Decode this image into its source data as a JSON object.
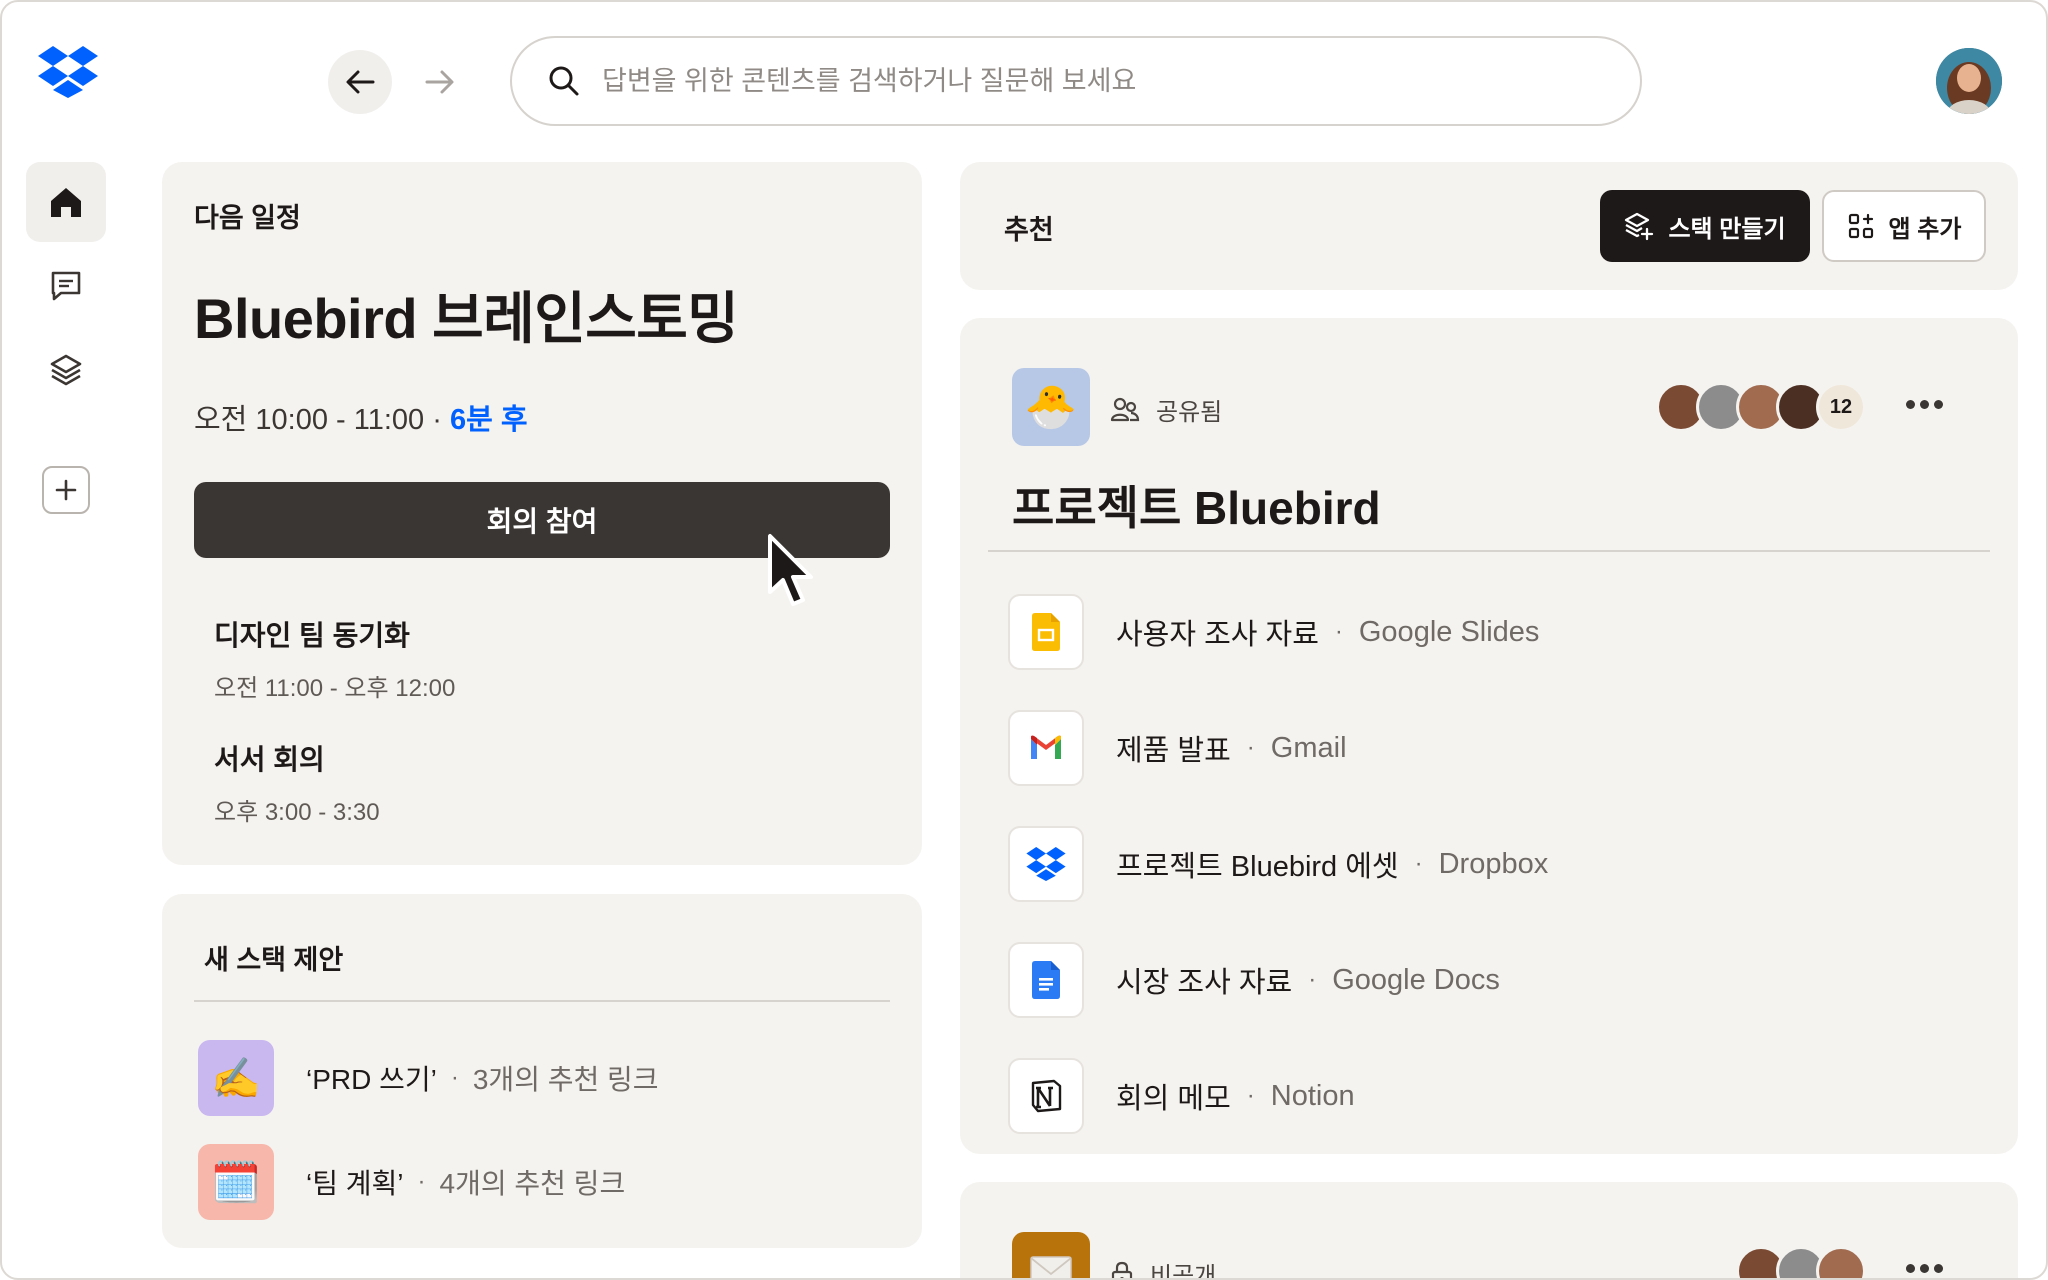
{
  "search": {
    "placeholder": "답변을 위한 콘텐츠를 검색하거나 질문해 보세요"
  },
  "next_meeting": {
    "label": "다음 일정",
    "title": "Bluebird 브레인스토밍",
    "time": "오전 10:00 - 11:00 · ",
    "starts_in": "6분 후",
    "join_label": "회의 참여",
    "events": [
      {
        "title": "디자인 팀 동기화",
        "time": "오전 11:00 - 오후 12:00"
      },
      {
        "title": "서서 회의",
        "time": "오후 3:00 - 3:30"
      }
    ]
  },
  "stack_suggestions": {
    "label": "새 스택 제안",
    "items": [
      {
        "name": "‘PRD 쓰기’",
        "meta": "3개의 추천 링크",
        "icon": "writing-hand-emoji",
        "bg": "#c9b7f0"
      },
      {
        "name": "‘팀 계획’",
        "meta": "4개의 추천 링크",
        "icon": "spiral-calendar-emoji",
        "bg": "#f7b7ab"
      }
    ]
  },
  "recommended": {
    "label": "추천",
    "create_stack_label": "스택 만들기",
    "add_app_label": "앱 추가"
  },
  "project": {
    "shared_label": "공유됨",
    "member_count": "12",
    "title": "프로젝트 Bluebird",
    "files": [
      {
        "name": "사용자 조사 자료",
        "app": "Google Slides",
        "icon": "google-slides-icon"
      },
      {
        "name": "제품 발표",
        "app": "Gmail",
        "icon": "gmail-icon"
      },
      {
        "name": "프로젝트 Bluebird 에셋",
        "app": "Dropbox",
        "icon": "dropbox-icon"
      },
      {
        "name": "시장 조사 자료",
        "app": "Google Docs",
        "icon": "google-docs-icon"
      },
      {
        "name": "회의 메모",
        "app": "Notion",
        "icon": "notion-icon"
      }
    ]
  },
  "private_card": {
    "label": "비공개"
  },
  "colors": {
    "accent": "#0061fe",
    "card_bg": "#f5f3f0",
    "join_button": "#3a3633"
  }
}
